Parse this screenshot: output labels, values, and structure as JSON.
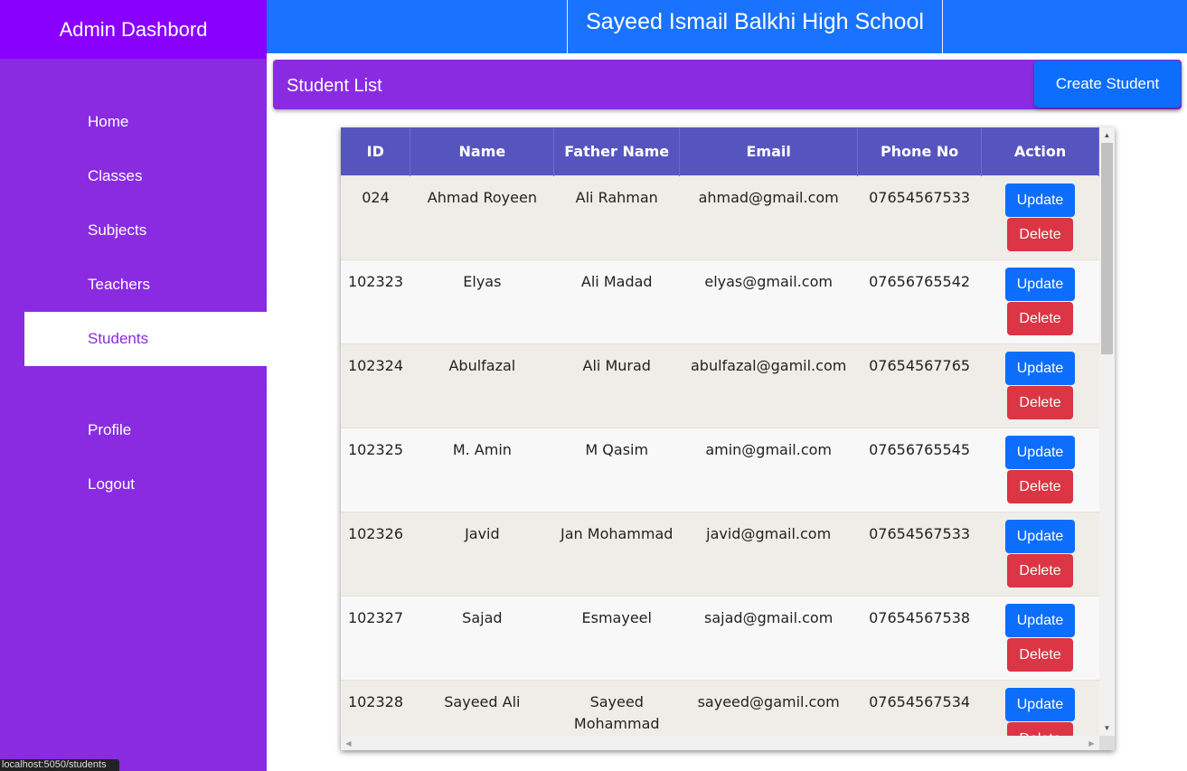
{
  "sidebar": {
    "title": "Admin Dashbord",
    "items": [
      {
        "label": "Home"
      },
      {
        "label": "Classes"
      },
      {
        "label": "Subjects"
      },
      {
        "label": "Teachers"
      },
      {
        "label": "Students",
        "active": true
      },
      {
        "label": "Profile"
      },
      {
        "label": "Logout"
      }
    ]
  },
  "header": {
    "school_name": "Sayeed Ismail Balkhi High School"
  },
  "section": {
    "title": "Student List",
    "create_label": "Create Student"
  },
  "table": {
    "columns": [
      "ID",
      "Name",
      "Father Name",
      "Email",
      "Phone No",
      "Action"
    ],
    "update_label": "Update",
    "delete_label": "Delete",
    "rows": [
      {
        "id": "024",
        "name": "Ahmad Royeen",
        "father": "Ali Rahman",
        "email": "ahmad@gmail.com",
        "phone": "07654567533"
      },
      {
        "id": "102323",
        "name": "Elyas",
        "father": "Ali Madad",
        "email": "elyas@gmail.com",
        "phone": "07656765542"
      },
      {
        "id": "102324",
        "name": "Abulfazal",
        "father": "Ali Murad",
        "email": "abulfazal@gamil.com",
        "phone": "07654567765"
      },
      {
        "id": "102325",
        "name": "M. Amin",
        "father": "M Qasim",
        "email": "amin@gmail.com",
        "phone": "07656765545"
      },
      {
        "id": "102326",
        "name": "Javid",
        "father": "Jan Mohammad",
        "email": "javid@gmail.com",
        "phone": "07654567533"
      },
      {
        "id": "102327",
        "name": "Sajad",
        "father": "Esmayeel",
        "email": "sajad@gmail.com",
        "phone": "07654567538"
      },
      {
        "id": "102328",
        "name": "Sayeed Ali",
        "father": "Sayeed Mohammad",
        "email": "sayeed@gamil.com",
        "phone": "07654567534"
      }
    ]
  },
  "status_bar": {
    "url": "localhost:5050/students"
  },
  "colors": {
    "sidebar": "#8a2be2",
    "sidebar_header": "#8a00ff",
    "topbar": "#1a73ff",
    "table_header": "#5655c0",
    "update": "#0d6efd",
    "delete": "#dc3545"
  }
}
